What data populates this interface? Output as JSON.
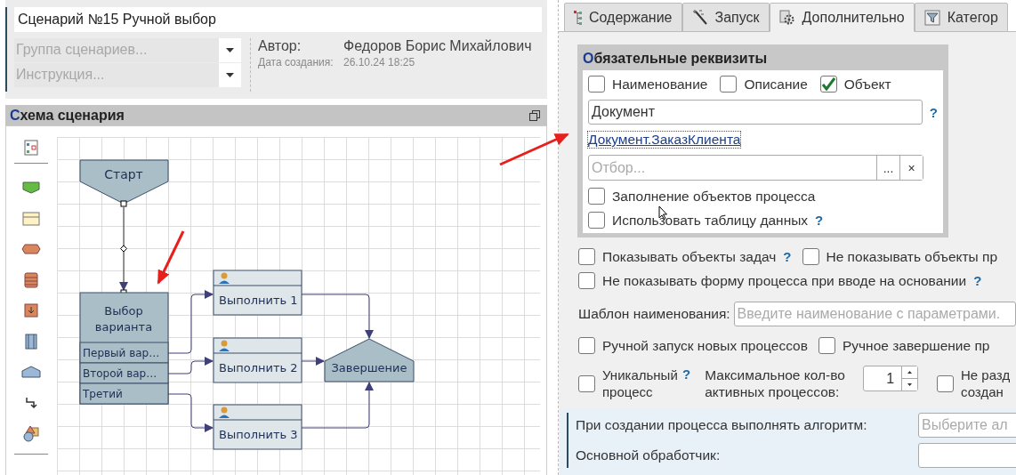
{
  "scenario": {
    "title": "Сценарий №15 Ручной выбор",
    "group_placeholder": "Группа сценариев...",
    "instruction_placeholder": "Инструкция...",
    "author_label": "Автор:",
    "author": "Федоров Борис Михайлович",
    "created_label": "Дата создания:",
    "created": "26.10.24 18:25"
  },
  "schema": {
    "title": "Схема сценария",
    "start": "Старт",
    "choice": {
      "title_lines": [
        "Выбор",
        "варианта"
      ],
      "options": [
        "Первый вар…",
        "Второй вар…",
        "Третий"
      ]
    },
    "tasks": [
      "Выполнить 1",
      "Выполнить 2",
      "Выполнить 3"
    ],
    "end": "Завершение"
  },
  "tabs": [
    {
      "label": "Содержание",
      "selected": false
    },
    {
      "label": "Запуск",
      "selected": false
    },
    {
      "label": "Дополнительно",
      "selected": true
    },
    {
      "label": "Категор",
      "selected": false
    }
  ],
  "required": {
    "title": "Обязательные реквизиты",
    "checks": [
      {
        "label": "Наименование",
        "checked": false
      },
      {
        "label": "Описание",
        "checked": false
      },
      {
        "label": "Объект",
        "checked": true
      }
    ],
    "object_value": "Документ",
    "object_help": "?",
    "object_link": "Документ.ЗаказКлиента",
    "filter_placeholder": "Отбор...",
    "filter_choose": "...",
    "filter_clear": "×",
    "options": [
      {
        "label": "Заполнение объектов процесса",
        "checked": false
      },
      {
        "label": "Использовать таблицу данных",
        "checked": false,
        "help": "?"
      }
    ]
  },
  "settings": {
    "rows": [
      [
        {
          "label": "Показывать объекты задач",
          "checked": false,
          "help": "?"
        },
        {
          "label": "Не показывать объекты пр",
          "checked": false
        }
      ],
      [
        {
          "label": "Не показывать форму процесса при вводе на основании",
          "checked": false,
          "help": "?"
        }
      ]
    ],
    "name_template_label": "Шаблон наименования:",
    "name_template_placeholder": "Введите наименование с параметрами.",
    "manual_row": [
      {
        "label": "Ручной запуск новых процессов",
        "checked": false
      },
      {
        "label": "Ручное завершение пр",
        "checked": false
      }
    ],
    "unique": {
      "label": "Уникальный процесс",
      "checked": false,
      "help": "?"
    },
    "max_label": "Максимальное кол-во активных процессов:",
    "max_value": "1",
    "no_split": {
      "label": "Не разд создан",
      "checked": false
    },
    "algorithm_label": "При создании процесса выполнять алгоритм:",
    "algorithm_placeholder": "Выберите ал",
    "handler_label": "Основной обработчик:"
  }
}
